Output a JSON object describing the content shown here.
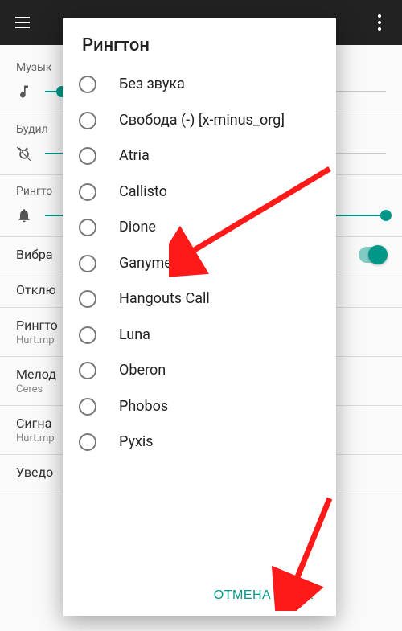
{
  "appbar": {},
  "bg": {
    "music_label": "Музык",
    "alarm_label": "Будил",
    "ringtone_label": "Рингто",
    "vibration_label": "Вибра",
    "mute_label": "Отклю",
    "ringtone2_label": "Рингто",
    "ringtone2_sub": "Hurt.mp",
    "melody_label": "Мелод",
    "melody_sub": "Ceres",
    "signal_label": "Сигна",
    "signal_sub": "Hurt.mp",
    "notif_label": "Уведо"
  },
  "dialog": {
    "title": "Рингтон",
    "options": [
      "Без звука",
      "Свобода (-) [x-minus_org]",
      "Atria",
      "Callisto",
      "Dione",
      "Ganymede",
      "Hangouts Call",
      "Luna",
      "Oberon",
      "Phobos",
      "Pyxis"
    ],
    "cancel": "ОТМЕНА",
    "ok": "ОК"
  }
}
